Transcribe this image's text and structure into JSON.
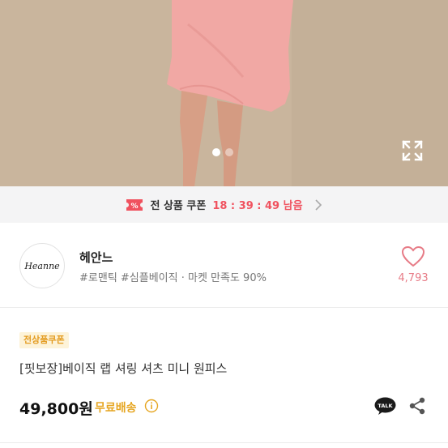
{
  "hero": {
    "image_icon": "product-photo-pink-mini-dress",
    "pagination_total": 2,
    "pagination_active": 1,
    "expand_icon": "expand-icon"
  },
  "coupon_bar": {
    "icon": "coupon-ticket-icon",
    "label": "전 상품 쿠폰",
    "timer": "18 : 39 : 49 남음",
    "accent_color": "#f0525f"
  },
  "seller": {
    "avatar_text": "Heanne",
    "name": "헤안느",
    "tags": "#로맨틱 #심플베이직 · 마켓 만족도 90%",
    "like_icon": "heart-icon",
    "like_count": "4,793"
  },
  "product": {
    "badge": "전상품쿠폰",
    "title": "[핏보장]베이직 랩 셔링 셔츠 미니 원피스",
    "price": "49,800원",
    "shipping": "무료배송",
    "shipping_color": "#e6a622",
    "info_icon": "info-icon",
    "talk_icon": "kakaotalk-icon",
    "talk_label": "TALK",
    "share_icon": "share-icon"
  }
}
